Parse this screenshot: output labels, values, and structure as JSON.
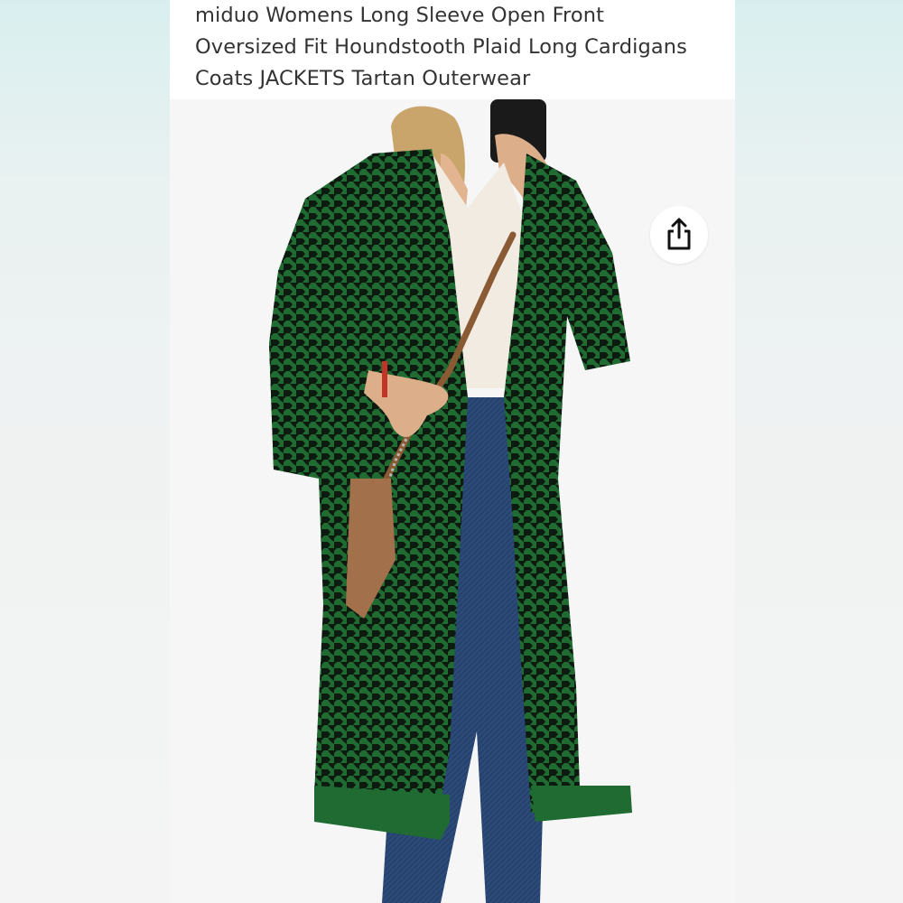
{
  "product": {
    "title_line1": "miduo Womens Long Sleeve Open Front",
    "title_line2": "Oversized Fit Houndstooth Plaid Long Cardigans",
    "title_line3": "Coats JACKETS Tartan Outerwear"
  },
  "image": {
    "share_icon": "share-icon",
    "coat_color": "#1f6b32",
    "pattern_dark": "#0c1a10",
    "background": "#f6f6f6"
  }
}
